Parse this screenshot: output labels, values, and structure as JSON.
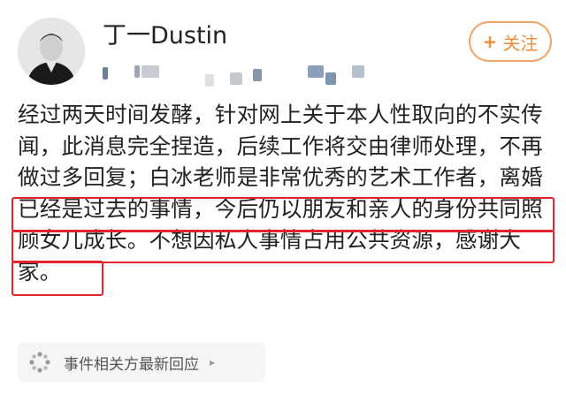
{
  "post": {
    "author": {
      "name": "丁一Dustin",
      "avatar_icon": "profile-photo"
    },
    "follow_button": {
      "plus": "+",
      "label": "关注"
    },
    "body": {
      "part1": "经过两天时间发酵，针对网上关于本人性取向的不实传闻，此消息完全捏造，后续工作将交由律师处理，不再做过多回复；",
      "part2": "白冰老师是非常优秀的艺术工作者，离婚已经是过去的事情，今后仍以朋友和亲人的身份共同照顾女儿成长。",
      "part3": "不想因私人事情占用公共资源，感谢大家。"
    },
    "related_events": {
      "icon": "sparkle-dots-icon",
      "label": "事件相关方最新回应",
      "chevron": "▸"
    }
  },
  "colors": {
    "follow_accent": "#f08c3a",
    "highlight_red": "#e3242b",
    "chip_bg": "#f5f5f5"
  }
}
